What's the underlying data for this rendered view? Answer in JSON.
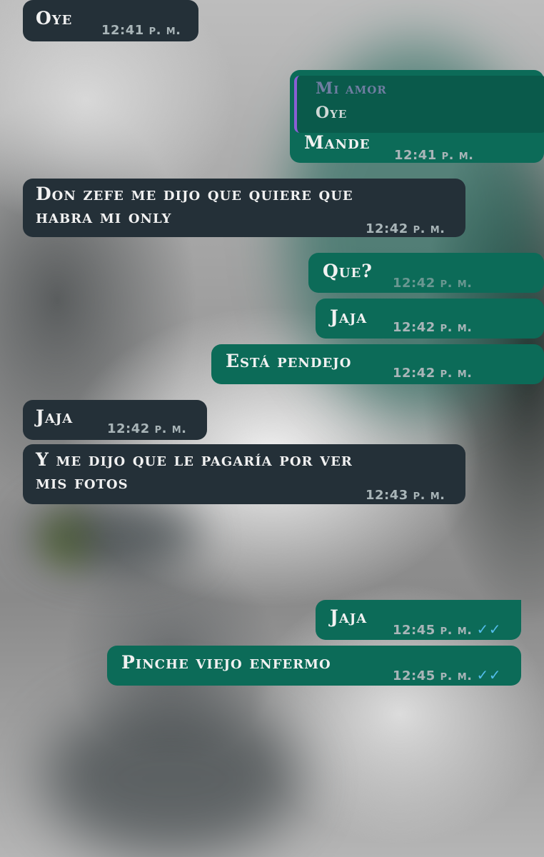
{
  "messages": [
    {
      "text": "Oye",
      "time": "12:41 p. m."
    },
    {
      "quote_author": "Mi amor",
      "quote_text": "Oye",
      "text": "Mande",
      "time": "12:41 p. m."
    },
    {
      "text_line1": "Don zefe me dijo que quiere que",
      "text_line2": "habra mi only",
      "time": "12:42 p. m."
    },
    {
      "text": "Que?",
      "time": "12:42 p. m."
    },
    {
      "text": "Jaja",
      "time": "12:42 p. m."
    },
    {
      "text": "Está pendejo",
      "time": "12:42 p. m."
    },
    {
      "text": "Jaja",
      "time": "12:42 p. m."
    },
    {
      "text_line1": "Y me dijo que le pagaría por ver",
      "text_line2": "mis fotos",
      "time": "12:43 p. m."
    },
    {
      "text": "Jaja",
      "time": "12:45 p. m.",
      "status": "✓✓"
    },
    {
      "text": "Pinche viejo enfermo",
      "time": "12:45 p. m.",
      "status": "✓✓"
    }
  ],
  "colors": {
    "incoming": "#243038",
    "outgoing": "#0c6b58",
    "read_ticks": "#53bdeb"
  }
}
